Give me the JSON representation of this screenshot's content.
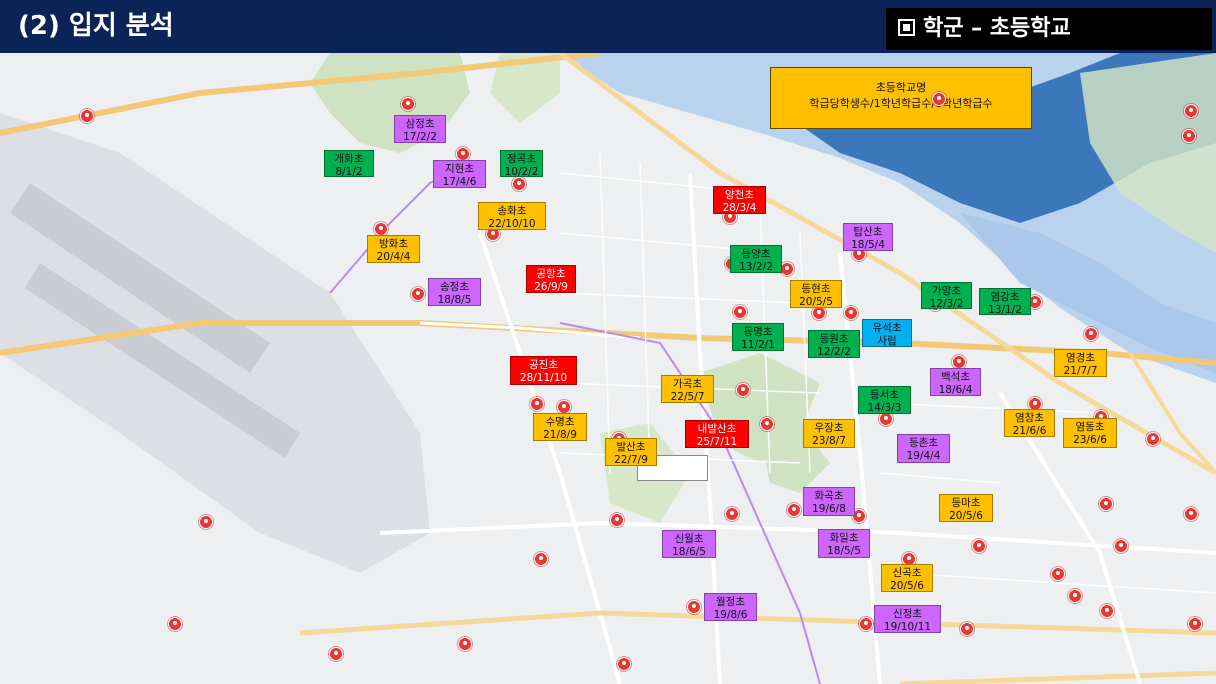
{
  "header": {
    "title": "(2) 입지 분석",
    "tag": "학군 – 초등학교"
  },
  "legend": {
    "line1": "초등학교명",
    "line2": "학급당학생수/1학년학급수/6학년학급수"
  },
  "colors": {
    "red": "#ff0000",
    "orange": "#ffc000",
    "green": "#00b050",
    "purple": "#cc66ff",
    "blue": "#00b0f0",
    "header": "#0b2357"
  },
  "schools": [
    {
      "name": "삼정초",
      "stats": "17/2/2",
      "color": "purple"
    },
    {
      "name": "개화초",
      "stats": "8/1/2",
      "color": "green"
    },
    {
      "name": "지현초",
      "stats": "17/4/6",
      "color": "purple"
    },
    {
      "name": "정곡초",
      "stats": "10/2/2",
      "color": "green"
    },
    {
      "name": "송화초",
      "stats": "22/10/10",
      "color": "orange"
    },
    {
      "name": "방화초",
      "stats": "20/4/4",
      "color": "orange"
    },
    {
      "name": "공항초",
      "stats": "26/9/9",
      "color": "red"
    },
    {
      "name": "송정초",
      "stats": "18/8/5",
      "color": "purple"
    },
    {
      "name": "양천초",
      "stats": "28/3/4",
      "color": "red"
    },
    {
      "name": "탑산초",
      "stats": "18/5/4",
      "color": "purple"
    },
    {
      "name": "등양초",
      "stats": "13/2/2",
      "color": "green"
    },
    {
      "name": "등현초",
      "stats": "20/5/5",
      "color": "orange"
    },
    {
      "name": "가양초",
      "stats": "12/3/2",
      "color": "green"
    },
    {
      "name": "염강초",
      "stats": "13/1/2",
      "color": "green"
    },
    {
      "name": "등명초",
      "stats": "11/2/1",
      "color": "green"
    },
    {
      "name": "등원초",
      "stats": "12/2/2",
      "color": "green"
    },
    {
      "name": "유석초",
      "stats": "사립",
      "color": "blue"
    },
    {
      "name": "공진초",
      "stats": "28/11/10",
      "color": "red"
    },
    {
      "name": "염경초",
      "stats": "21/7/7",
      "color": "orange"
    },
    {
      "name": "가곡초",
      "stats": "22/5/7",
      "color": "orange"
    },
    {
      "name": "백석초",
      "stats": "18/6/4",
      "color": "purple"
    },
    {
      "name": "등서초",
      "stats": "14/3/3",
      "color": "green"
    },
    {
      "name": "수명초",
      "stats": "21/8/9",
      "color": "orange"
    },
    {
      "name": "내발산초",
      "stats": "25/7/11",
      "color": "red"
    },
    {
      "name": "우장초",
      "stats": "23/8/7",
      "color": "orange"
    },
    {
      "name": "염창초",
      "stats": "21/6/6",
      "color": "orange"
    },
    {
      "name": "염동초",
      "stats": "23/6/6",
      "color": "orange"
    },
    {
      "name": "발산초",
      "stats": "22/7/9",
      "color": "orange"
    },
    {
      "name": "등촌초",
      "stats": "19/4/4",
      "color": "purple"
    },
    {
      "name": "화곡초",
      "stats": "19/6/8",
      "color": "purple"
    },
    {
      "name": "등마초",
      "stats": "20/5/6",
      "color": "orange"
    },
    {
      "name": "신월초",
      "stats": "18/6/5",
      "color": "purple"
    },
    {
      "name": "화일초",
      "stats": "18/5/5",
      "color": "purple"
    },
    {
      "name": "신곡초",
      "stats": "20/5/6",
      "color": "orange"
    },
    {
      "name": "월정초",
      "stats": "19/8/6",
      "color": "purple"
    },
    {
      "name": "신정초",
      "stats": "19/10/11",
      "color": "purple"
    }
  ]
}
